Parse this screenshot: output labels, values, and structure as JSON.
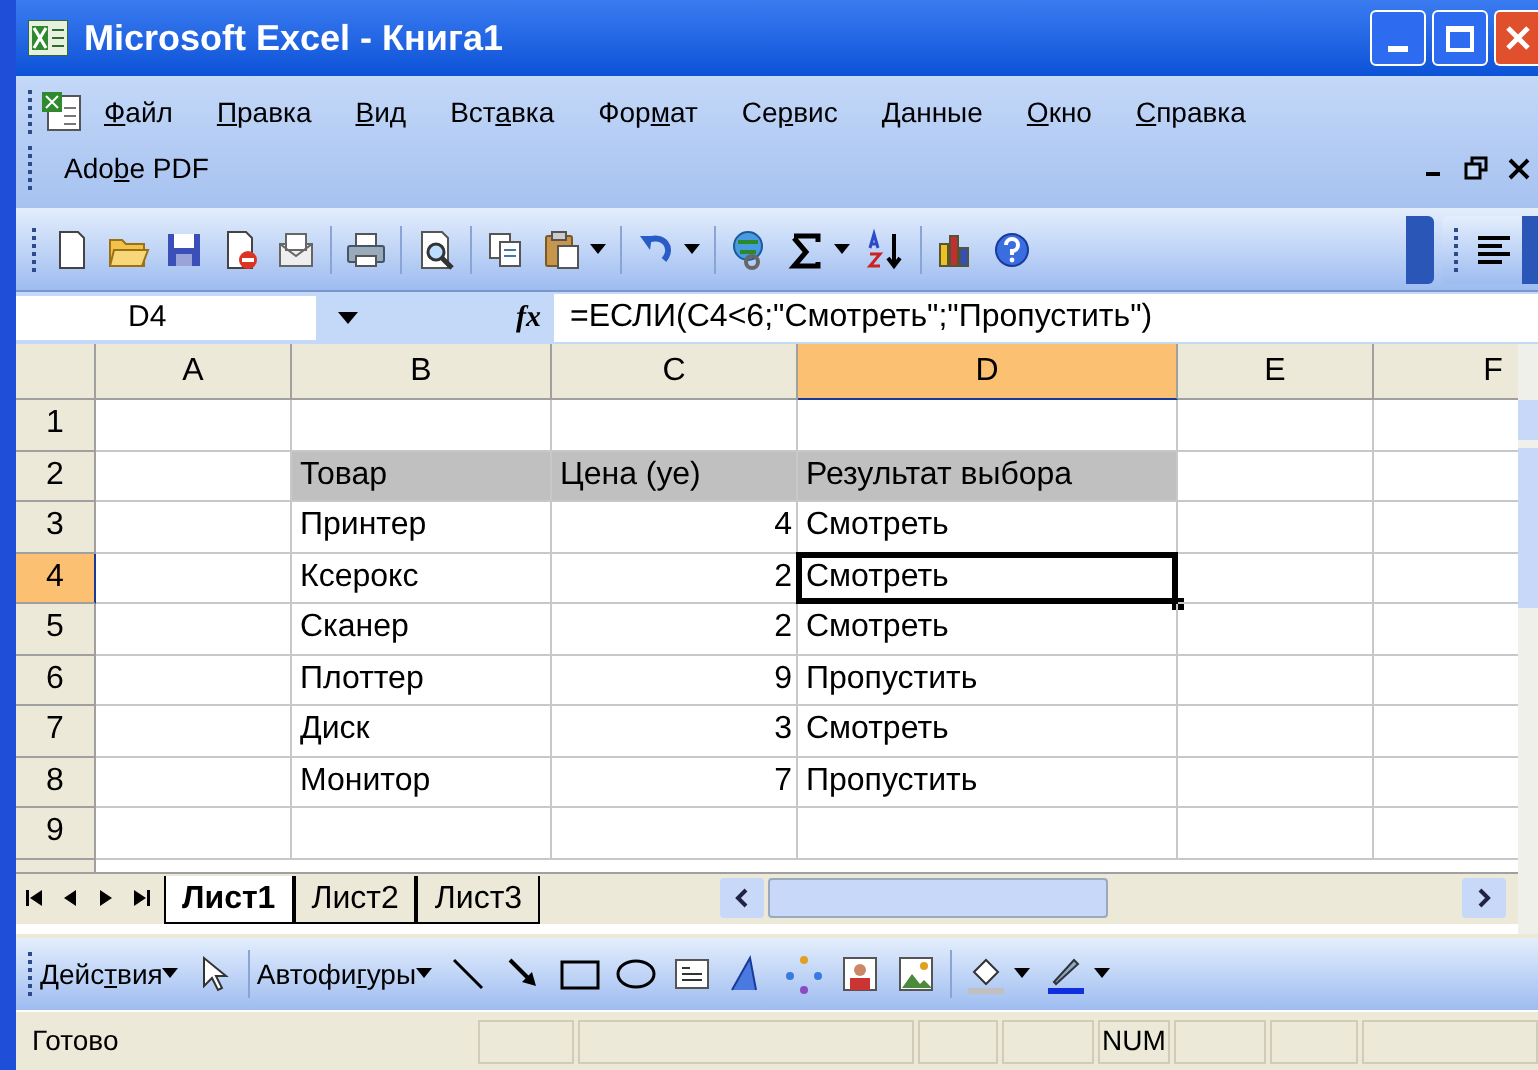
{
  "window": {
    "title": "Microsoft Excel - Книга1"
  },
  "menu": {
    "items": [
      {
        "key": "Ф",
        "post": "айл"
      },
      {
        "key": "П",
        "post": "равка"
      },
      {
        "key": "В",
        "post": "ид"
      },
      {
        "pre": "Вст",
        "key": "а",
        "post": "вка"
      },
      {
        "pre": "Фор",
        "key": "м",
        "post": "ат"
      },
      {
        "pre": "Се",
        "key": "р",
        "post": "вис"
      },
      {
        "key": "Д",
        "post": "анные"
      },
      {
        "key": "О",
        "post": "кно"
      },
      {
        "key": "С",
        "post": "правка"
      }
    ],
    "second_row": {
      "pre": "Ado",
      "key": "b",
      "post": "e PDF"
    }
  },
  "formula_bar": {
    "name_box": "D4",
    "fx": "fx",
    "formula": "=ЕСЛИ(C4<6;\"Смотреть\";\"Пропустить\")"
  },
  "columns": [
    {
      "label": "A",
      "selected": false
    },
    {
      "label": "B",
      "selected": false
    },
    {
      "label": "C",
      "selected": false
    },
    {
      "label": "D",
      "selected": true
    },
    {
      "label": "E",
      "selected": false
    },
    {
      "label": "F",
      "selected": false
    }
  ],
  "rows": [
    {
      "label": "1",
      "selected": false,
      "kind": "plain",
      "cells": [
        "",
        "",
        "",
        "",
        "",
        ""
      ]
    },
    {
      "label": "2",
      "selected": false,
      "kind": "header",
      "cells": [
        "",
        "Товар",
        "Цена (уе)",
        "Результат выбора",
        "",
        ""
      ]
    },
    {
      "label": "3",
      "selected": false,
      "kind": "plain",
      "cells": [
        "",
        "Принтер",
        "4",
        "Смотреть",
        "",
        ""
      ]
    },
    {
      "label": "4",
      "selected": true,
      "kind": "plain",
      "cells": [
        "",
        "Ксерокс",
        "2",
        "Смотреть",
        "",
        ""
      ]
    },
    {
      "label": "5",
      "selected": false,
      "kind": "plain",
      "cells": [
        "",
        "Сканер",
        "2",
        "Смотреть",
        "",
        ""
      ]
    },
    {
      "label": "6",
      "selected": false,
      "kind": "plain",
      "cells": [
        "",
        "Плоттер",
        "9",
        "Пропустить",
        "",
        ""
      ]
    },
    {
      "label": "7",
      "selected": false,
      "kind": "plain",
      "cells": [
        "",
        "Диск",
        "3",
        "Смотреть",
        "",
        ""
      ]
    },
    {
      "label": "8",
      "selected": false,
      "kind": "plain",
      "cells": [
        "",
        "Монитор",
        "7",
        "Пропустить",
        "",
        ""
      ]
    },
    {
      "label": "9",
      "selected": false,
      "kind": "plain",
      "cells": [
        "",
        "",
        "",
        "",
        "",
        ""
      ]
    }
  ],
  "sheet_tabs": [
    {
      "label": "Лист1",
      "selected": true
    },
    {
      "label": "Лист2",
      "selected": false
    },
    {
      "label": "Лист3",
      "selected": false
    }
  ],
  "drawing_toolbar": {
    "actions": {
      "pre": "Дейс",
      "key": "т",
      "post": "вия"
    },
    "autoshapes": {
      "pre": "Автофи",
      "key": "г",
      "post": "уры"
    }
  },
  "status_bar": {
    "text": "Готово",
    "num": "NUM"
  }
}
